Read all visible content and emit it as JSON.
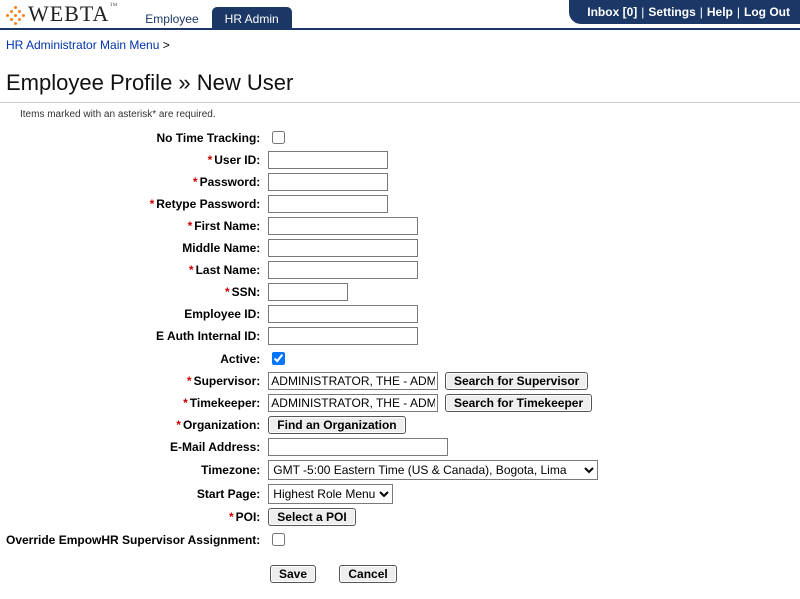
{
  "logo": {
    "text": "WEBTA",
    "tm": "™"
  },
  "tabs": {
    "employee": "Employee",
    "hr_admin": "HR Admin"
  },
  "topright": {
    "inbox_label": "Inbox",
    "inbox_count": "[0]",
    "settings": "Settings",
    "help": "Help",
    "logout": "Log Out"
  },
  "breadcrumb": {
    "link": "HR Administrator Main Menu",
    "sep": " >"
  },
  "title": "Employee Profile » New User",
  "note": "Items marked with an asterisk* are required.",
  "labels": {
    "no_time_tracking": "No Time Tracking:",
    "user_id": "User ID:",
    "password": "Password:",
    "retype_password": "Retype Password:",
    "first_name": "First Name:",
    "middle_name": "Middle Name:",
    "last_name": "Last Name:",
    "ssn": "SSN:",
    "employee_id": "Employee ID:",
    "e_auth_id": "E Auth Internal ID:",
    "active": "Active:",
    "supervisor": "Supervisor:",
    "timekeeper": "Timekeeper:",
    "organization": "Organization:",
    "email": "E-Mail Address:",
    "timezone": "Timezone:",
    "start_page": "Start Page:",
    "poi": "POI:",
    "override": "Override EmpowHR Supervisor Assignment:"
  },
  "values": {
    "supervisor": "ADMINISTRATOR, THE - ADMIN",
    "timekeeper": "ADMINISTRATOR, THE - ADMIN",
    "timezone_selected": "GMT -5:00 Eastern Time (US & Canada), Bogota, Lima",
    "start_page_selected": "Highest Role Menu"
  },
  "buttons": {
    "search_supervisor": "Search for Supervisor",
    "search_timekeeper": "Search for Timekeeper",
    "find_org": "Find an Organization",
    "select_poi": "Select a POI",
    "save": "Save",
    "cancel": "Cancel"
  }
}
